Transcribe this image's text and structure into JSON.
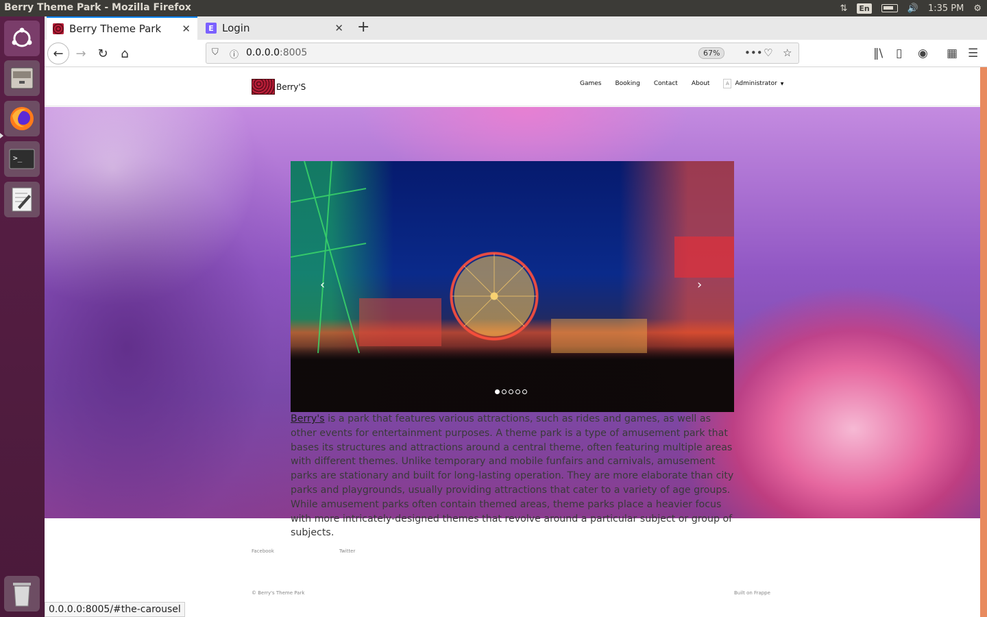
{
  "os": {
    "window_title": "Berry Theme Park - Mozilla Firefox",
    "lang_badge": "En",
    "clock": "1:35 PM"
  },
  "browser": {
    "tabs": [
      {
        "label": "Berry Theme Park"
      },
      {
        "label": "Login",
        "favicon_letter": "E"
      }
    ],
    "url_host": "0.0.0.0",
    "url_port": ":8005",
    "zoom": "67%",
    "status_url": "0.0.0.0:8005/#the-carousel"
  },
  "site": {
    "brand": "Berry'S",
    "nav": [
      "Games",
      "Booking",
      "Contact",
      "About"
    ],
    "avatar_letter": "A",
    "admin_label": "Administrator",
    "carousel": {
      "indicator_count": 5,
      "active_index": 0
    },
    "intro_link": "Berry's",
    "intro_text": " is a park that features various attractions, such as rides and games, as well as other events for entertainment purposes. A theme park is a type of amusement park that bases its structures and attractions around a central theme, often featuring multiple areas with different themes. Unlike temporary and mobile funfairs and carnivals, amusement parks are stationary and built for long-lasting operation. They are more elaborate than city parks and playgrounds, usually providing attractions that cater to a variety of age groups. While amusement parks often contain themed areas, theme parks place a heavier focus with more intricately-designed themes that revolve around a particular subject or group of subjects.",
    "footer_links": [
      "Facebook",
      "Twitter"
    ],
    "copyright": "© Berry's Theme Park",
    "built_on": "Built on Frappe"
  }
}
